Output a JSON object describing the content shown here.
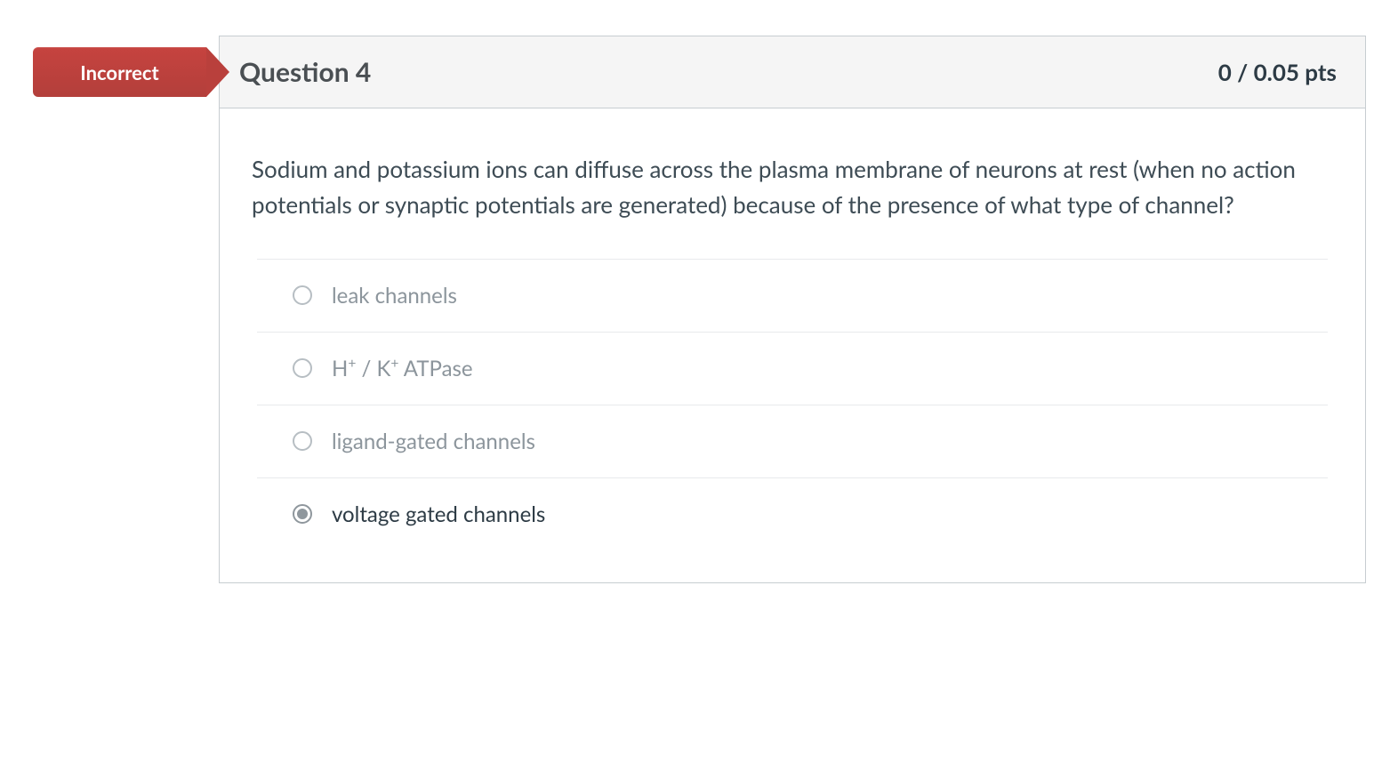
{
  "status": {
    "label": "Incorrect"
  },
  "header": {
    "title": "Question 4",
    "points": "0 / 0.05 pts"
  },
  "question": {
    "text": "Sodium and potassium ions can diffuse across the plasma membrane of neurons at rest (when no action potentials or synaptic potentials are generated) because of the presence of what type of channel?"
  },
  "answers": [
    {
      "label": "leak channels",
      "selected": false
    },
    {
      "label_html": "H<sup>+</sup> / K<sup>+</sup> ATPase",
      "label": "H+ / K+ ATPase",
      "selected": false
    },
    {
      "label": "ligand-gated channels",
      "selected": false
    },
    {
      "label": "voltage gated channels",
      "selected": true
    }
  ]
}
